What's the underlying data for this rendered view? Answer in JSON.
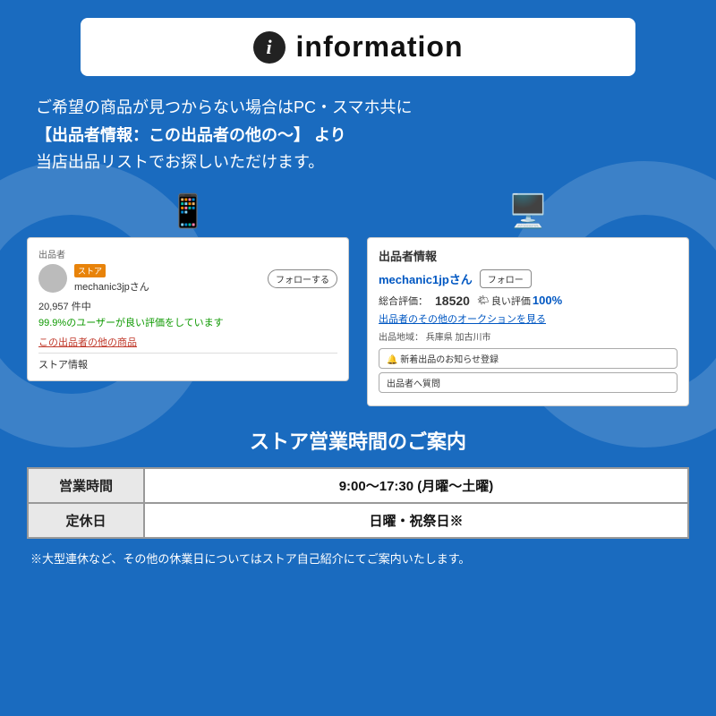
{
  "header": {
    "title": "information",
    "icon_label": "i"
  },
  "main_text": {
    "line1": "ご希望の商品が見つからない場合はPC・スマホ共に",
    "line2": "【出品者情報：この出品者の他の〜】 より",
    "line3": "当店出品リストでお探しいただけます。"
  },
  "left_screenshot": {
    "section_label": "出品者",
    "store_badge": "ストア",
    "seller_name": "mechanic3jpさん",
    "follow_button": "フォローする",
    "stats": "20,957 件中",
    "rating_text": "99.9%のユーザーが良い評価をしています",
    "link_text": "この出品者の他の商品",
    "bottom_label": "ストア情報"
  },
  "right_screenshot": {
    "section_label": "出品者情報",
    "seller_name": "mechanic1jpさん",
    "follow_button": "フォロー",
    "rating_label": "総合評価：",
    "rating_num": "18520",
    "good_label": "良い評価",
    "good_pct": "100%",
    "auction_link": "出品者のその他のオークションを見る",
    "location_label": "出品地域：",
    "location_value": "兵庫県 加古川市",
    "new_listing_btn": "🔔 新着出品のお知らせ登録",
    "question_btn": "出品者へ質問"
  },
  "store_hours": {
    "title": "ストア営業時間のご案内",
    "rows": [
      {
        "label": "営業時間",
        "value": "9:00〜17:30 (月曜〜土曜)"
      },
      {
        "label": "定休日",
        "value": "日曜・祝祭日※"
      }
    ],
    "footer_note": "※大型連休など、その他の休業日についてはストア自己紹介にてご案内いたします。"
  }
}
